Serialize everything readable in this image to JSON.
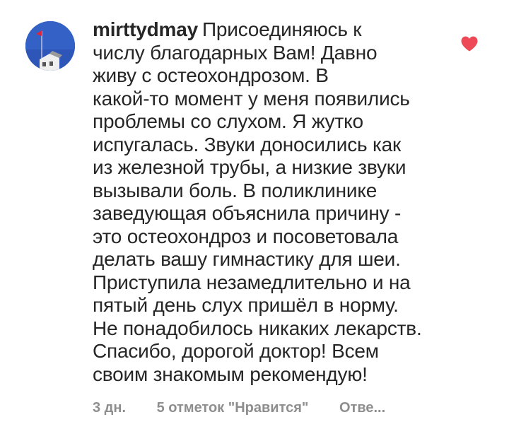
{
  "comment": {
    "username": "mirttydmay",
    "lines": [
      "Присоединяюсь к",
      "числу благодарных Вам! Давно",
      "живу с остеохондрозом. В",
      "какой-то момент у меня появились",
      "проблемы со слухом.  Я жутко",
      "испугалась. Звуки доносились как",
      "из железной трубы, а низкие звуки",
      "вызывали боль. В поликлинике",
      "заведующая объяснила причину -",
      "это остеохондроз и посоветовала",
      "делать вашу гимнастику для шеи.",
      "Приступила незамедлительно и на",
      "пятый день слух пришёл в норму.",
      "Не понадобилось никаких лекарств.",
      "Спасибо, дорогой доктор! Всем",
      "своим знакомым рекомендую!"
    ],
    "time": "3 дн.",
    "likes": "5 отметок \"Нравится\"",
    "reply": "Отве..."
  },
  "icons": {
    "like": "heart-icon",
    "avatar": "avatar-image"
  },
  "colors": {
    "text": "#262626",
    "meta": "#8e8e8e",
    "heart": "#ed4956",
    "avatar_sky": "#2d56b8"
  }
}
